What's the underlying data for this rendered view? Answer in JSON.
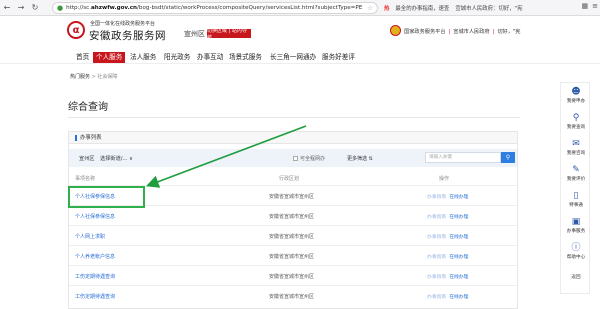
{
  "browser": {
    "url_prefix": "http://sc.",
    "url_host": "ahzwfw.gov.cn",
    "url_rest": "/bog-bsdt/static/workProcess/compositeQuery/servicesList.html?subjectType=PE",
    "hot_label": "热",
    "news1": "最全的办事指南，速查",
    "news2": "宣城市人民政府：切好，\"宪"
  },
  "header": {
    "site_sub": "全国一体化在线政务服务平台",
    "site_title": "安徽政务服务网",
    "region": "宣州区",
    "region_btn": "切换区域 | 站内导航",
    "right_text1": "国家政务服务平台",
    "right_text2": "宣城市人民政府",
    "right_text3": "切好，\"宪"
  },
  "nav": {
    "items": [
      "首页",
      "个人服务",
      "法人服务",
      "阳光政务",
      "办事互动",
      "场景式服务",
      "长三角一网通办",
      "服务好差评"
    ]
  },
  "crumb": {
    "current": "热门服务",
    "sep": ">",
    "rest": "社会保障"
  },
  "page": {
    "title": "综合查询"
  },
  "section": {
    "head": "办事列表",
    "filter_label": "宣州区",
    "filter_select": "选择街道/... ∨",
    "checkbox_label": "可全程网办",
    "more": "更多筛选 ⇅",
    "search_placeholder": "请输入关键",
    "col_name": "事项名称",
    "col_dept": "行政区划",
    "col_ops": "操作"
  },
  "rows": [
    {
      "name": "个人社保参保信息",
      "dept": "安徽省宣城市宣州区",
      "op1": "办事指南",
      "op2": "在线办理"
    },
    {
      "name": "个人社保参保信息",
      "dept": "安徽省宣城市宣州区",
      "op1": "办事指南",
      "op2": "在线办理"
    },
    {
      "name": "个人网上求职",
      "dept": "安徽省宣城市宣州区",
      "op1": "办事指南",
      "op2": "在线办理"
    },
    {
      "name": "个人养老帐户信息",
      "dept": "安徽省宣城市宣州区",
      "op1": "办事指南",
      "op2": "在线办理"
    },
    {
      "name": "工伤定期待遇查询",
      "dept": "安徽省宣城市宣州区",
      "op1": "办事指南",
      "op2": "在线办理"
    },
    {
      "name": "工伤定期待遇查询",
      "dept": "安徽省宣城市宣州区",
      "op1": "办事指南",
      "op2": "在线办理"
    }
  ],
  "rtool": {
    "items": [
      {
        "icon": "person-icon",
        "label": "我要申办"
      },
      {
        "icon": "search-icon",
        "label": "我要查询"
      },
      {
        "icon": "chat-icon",
        "label": "我要咨询"
      },
      {
        "icon": "edit-icon",
        "label": "我要评价"
      },
      {
        "icon": "mobile-icon",
        "label": "特事通"
      },
      {
        "icon": "monitor-icon",
        "label": "办事服务"
      },
      {
        "icon": "help-icon",
        "label": "帮助中心"
      },
      {
        "icon": "top-icon",
        "label": "返回"
      }
    ]
  },
  "colors": {
    "brand_red": "#c8161d",
    "link_blue": "#2a6fd6",
    "highlight_green": "#2fb04a",
    "arrow_green": "#1f9d3f"
  }
}
